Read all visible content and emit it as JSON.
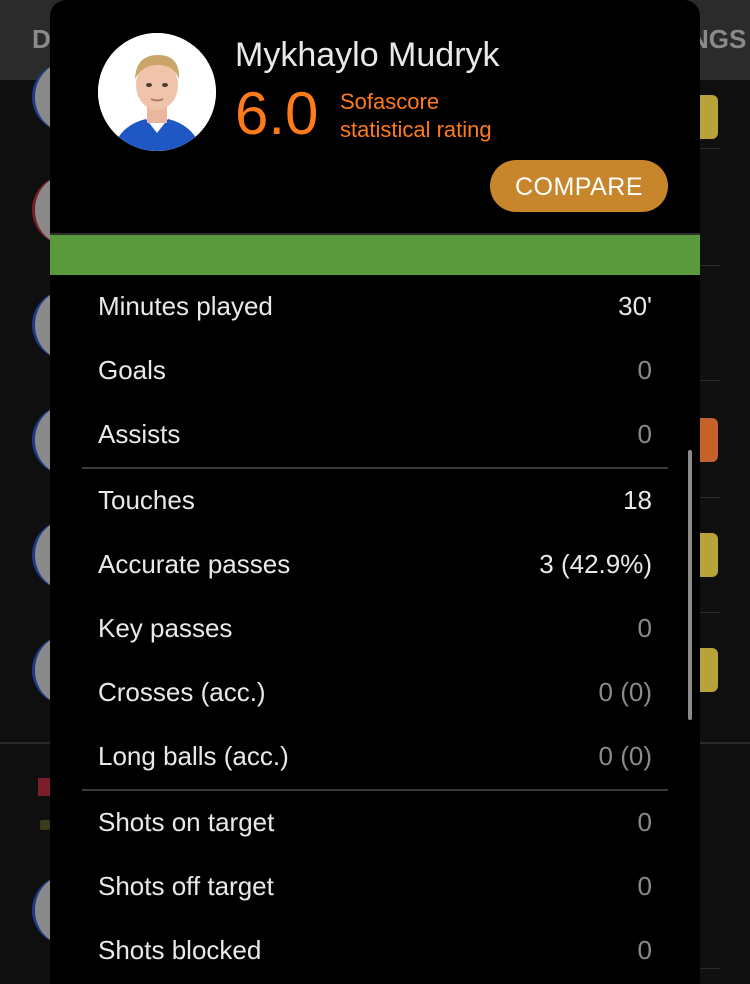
{
  "background": {
    "tab_left": "D",
    "tab_right": "NGS"
  },
  "player": {
    "name": "Mykhaylo Mudryk",
    "rating": "6.0",
    "rating_label_line1": "Sofascore",
    "rating_label_line2": "statistical rating",
    "rating_color": "#ff7a1a",
    "rating_bar_color": "#5b9a3c"
  },
  "actions": {
    "compare_label": "COMPARE",
    "compare_color": "#c8862c"
  },
  "stats": {
    "group1": [
      {
        "label": "Minutes played",
        "value": "30'"
      },
      {
        "label": "Goals",
        "value": "0"
      },
      {
        "label": "Assists",
        "value": "0"
      }
    ],
    "group2": [
      {
        "label": "Touches",
        "value": "18"
      },
      {
        "label": "Accurate passes",
        "value": "3 (42.9%)"
      },
      {
        "label": "Key passes",
        "value": "0"
      },
      {
        "label": "Crosses (acc.)",
        "value": "0 (0)"
      },
      {
        "label": "Long balls (acc.)",
        "value": "0 (0)"
      }
    ],
    "group3": [
      {
        "label": "Shots on target",
        "value": "0"
      },
      {
        "label": "Shots off target",
        "value": "0"
      },
      {
        "label": "Shots blocked",
        "value": "0"
      }
    ]
  }
}
